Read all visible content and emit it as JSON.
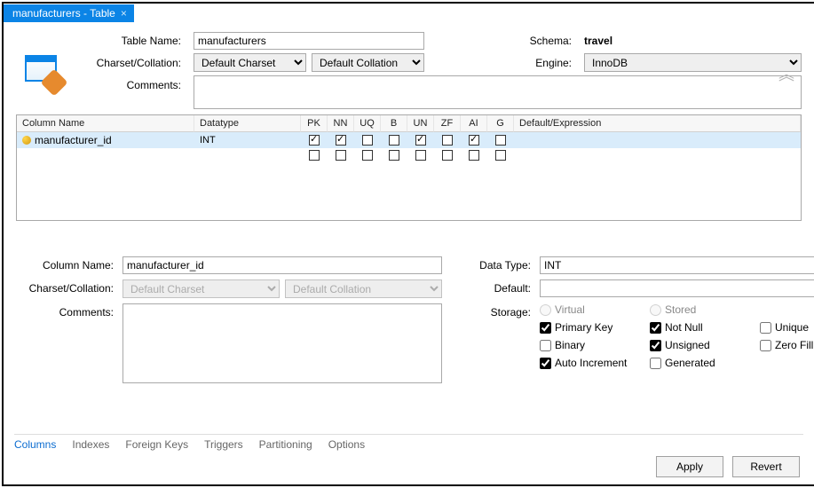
{
  "tab": {
    "title": "manufacturers - Table"
  },
  "form": {
    "table_name_label": "Table Name:",
    "table_name": "manufacturers",
    "schema_label": "Schema:",
    "schema": "travel",
    "charset_label": "Charset/Collation:",
    "charset": "Default Charset",
    "collation": "Default Collation",
    "engine_label": "Engine:",
    "engine": "InnoDB",
    "comments_label": "Comments:",
    "comments": ""
  },
  "grid": {
    "headers": {
      "name": "Column Name",
      "datatype": "Datatype",
      "pk": "PK",
      "nn": "NN",
      "uq": "UQ",
      "b": "B",
      "un": "UN",
      "zf": "ZF",
      "ai": "AI",
      "g": "G",
      "default": "Default/Expression"
    },
    "rows": [
      {
        "name": "manufacturer_id",
        "datatype": "INT",
        "pk": true,
        "nn": true,
        "uq": false,
        "b": false,
        "un": true,
        "zf": false,
        "ai": true,
        "g": false,
        "default": ""
      }
    ]
  },
  "detail": {
    "column_name_label": "Column Name:",
    "column_name": "manufacturer_id",
    "datatype_label": "Data Type:",
    "datatype": "INT",
    "charset_label": "Charset/Collation:",
    "charset": "Default Charset",
    "collation": "Default Collation",
    "default_label": "Default:",
    "default": "",
    "comments_label": "Comments:",
    "comments": "",
    "storage_label": "Storage:",
    "virtual_label": "Virtual",
    "stored_label": "Stored",
    "pk_label": "Primary Key",
    "nn_label": "Not Null",
    "uq_label": "Unique",
    "b_label": "Binary",
    "un_label": "Unsigned",
    "zf_label": "Zero Fill",
    "ai_label": "Auto Increment",
    "g_label": "Generated",
    "pk": true,
    "nn": true,
    "uq": false,
    "b": false,
    "un": true,
    "zf": false,
    "ai": true,
    "g": false
  },
  "bottom_tabs": {
    "columns": "Columns",
    "indexes": "Indexes",
    "fks": "Foreign Keys",
    "triggers": "Triggers",
    "partitioning": "Partitioning",
    "options": "Options"
  },
  "actions": {
    "apply": "Apply",
    "revert": "Revert"
  }
}
